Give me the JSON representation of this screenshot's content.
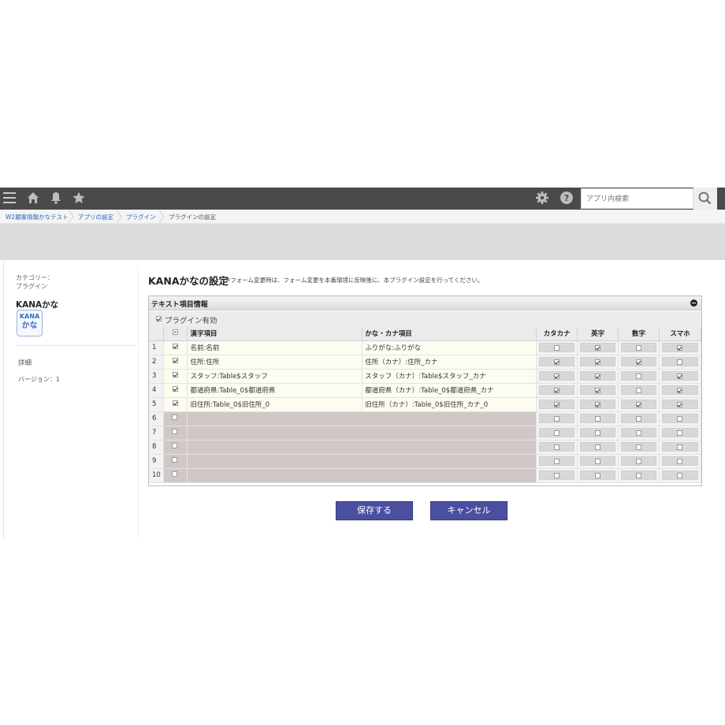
{
  "header": {
    "search_placeholder": "アプリ内検索",
    "icons": [
      "menu-icon",
      "home-icon",
      "bell-icon",
      "star-icon",
      "gear-icon",
      "help-icon",
      "search-icon"
    ]
  },
  "breadcrumb": [
    "W2顧客情報かなテスト",
    "アプリの設定",
    "プラグイン",
    "プラグインの設定"
  ],
  "sidebar": {
    "category_label": "カテゴリー：",
    "category_value": "プラグイン",
    "app_name": "KANAかな",
    "app_icon_line1": "KANA",
    "app_icon_line2": "かな",
    "detail_label": "詳細",
    "version_label": "バージョン：1"
  },
  "main": {
    "title": "KANAかなの設定",
    "note": "※フォーム変更時は、フォーム変更を本番環境に反映後に、本プラグイン設定を行ってください。",
    "section_title": "テキスト項目情報",
    "plugin_enabled_label": "プラグイン有効",
    "plugin_enabled": true
  },
  "table": {
    "headers": {
      "kanji": "漢字項目",
      "kana": "かな・カナ項目",
      "katakana": "カタカナ",
      "eiji": "英字",
      "suji": "数字",
      "sumaho": "スマホ"
    },
    "rows": [
      {
        "num": "1",
        "checked": true,
        "kanji": "名前:名前",
        "kana": "ふりがな:ふりがな",
        "opts": [
          false,
          true,
          false,
          true
        ]
      },
      {
        "num": "2",
        "checked": true,
        "kanji": "住所:住所",
        "kana": "住所（カナ）:住所_カナ",
        "opts": [
          true,
          true,
          true,
          false
        ]
      },
      {
        "num": "3",
        "checked": true,
        "kanji": "スタッフ:Table$スタッフ",
        "kana": "スタッフ（カナ）:Table$スタッフ_カナ",
        "opts": [
          true,
          true,
          false,
          true
        ]
      },
      {
        "num": "4",
        "checked": true,
        "kanji": "都道府県:Table_0$都道府県",
        "kana": "都道府県（カナ）:Table_0$都道府県_カナ",
        "opts": [
          true,
          true,
          false,
          true
        ]
      },
      {
        "num": "5",
        "checked": true,
        "kanji": "旧住所:Table_0$旧住所_0",
        "kana": "旧住所（カナ）:Table_0$旧住所_カナ_0",
        "opts": [
          true,
          true,
          true,
          true
        ]
      },
      {
        "num": "6",
        "checked": false,
        "kanji": "",
        "kana": "",
        "opts": [
          false,
          false,
          false,
          false
        ]
      },
      {
        "num": "7",
        "checked": false,
        "kanji": "",
        "kana": "",
        "opts": [
          false,
          false,
          false,
          false
        ]
      },
      {
        "num": "8",
        "checked": false,
        "kanji": "",
        "kana": "",
        "opts": [
          false,
          false,
          false,
          false
        ]
      },
      {
        "num": "9",
        "checked": false,
        "kanji": "",
        "kana": "",
        "opts": [
          false,
          false,
          false,
          false
        ]
      },
      {
        "num": "10",
        "checked": false,
        "kanji": "",
        "kana": "",
        "opts": [
          false,
          false,
          false,
          false
        ]
      }
    ]
  },
  "buttons": {
    "save": "保存する",
    "cancel": "キャンセル"
  },
  "colors": {
    "header_bar": "#4a4a4a",
    "button": "#4b4fa0",
    "empty_row": "#d2c7c7",
    "filled_row": "#fdfcf1",
    "link": "#2b66b6"
  }
}
